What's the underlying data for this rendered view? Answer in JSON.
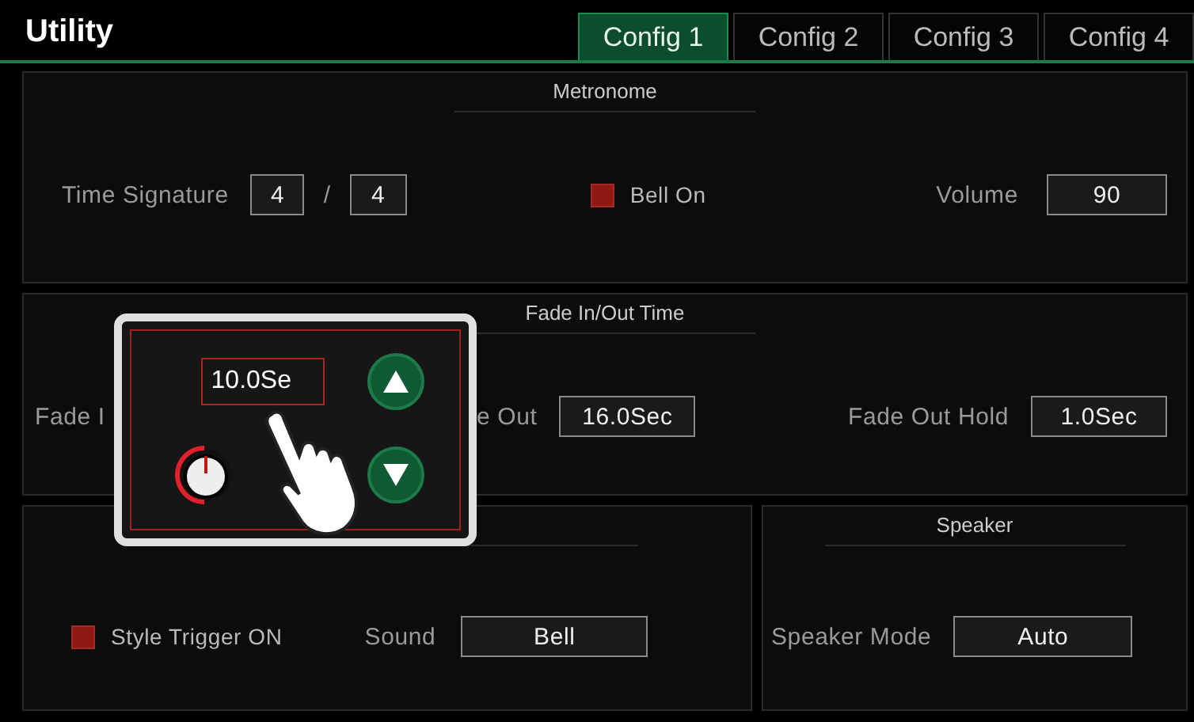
{
  "title": "Utility",
  "tabs": [
    {
      "label": "Config 1",
      "selected": true
    },
    {
      "label": "Config 2",
      "selected": false
    },
    {
      "label": "Config 3",
      "selected": false
    },
    {
      "label": "Config 4",
      "selected": false
    }
  ],
  "metronome": {
    "title": "Metronome",
    "time_signature": {
      "label": "Time Signature",
      "numerator": "4",
      "separator": "/",
      "denominator": "4"
    },
    "bell": {
      "label": "Bell On",
      "checked": true
    },
    "volume": {
      "label": "Volume",
      "value": "90"
    }
  },
  "fade": {
    "title": "Fade In/Out Time",
    "fade_in_label": "Fade I",
    "fade_out_label": "e Out",
    "fade_out_value": "16.0Sec",
    "hold_label": "Fade Out Hold",
    "hold_value": "1.0Sec"
  },
  "style_trigger": {
    "checkbox": {
      "label": "Style Trigger ON",
      "checked": true
    },
    "sound": {
      "label": "Sound",
      "value": "Bell"
    }
  },
  "speaker": {
    "title": "Speaker",
    "mode": {
      "label": "Speaker Mode",
      "value": "Auto"
    }
  },
  "popup": {
    "value": "10.0Se"
  }
}
